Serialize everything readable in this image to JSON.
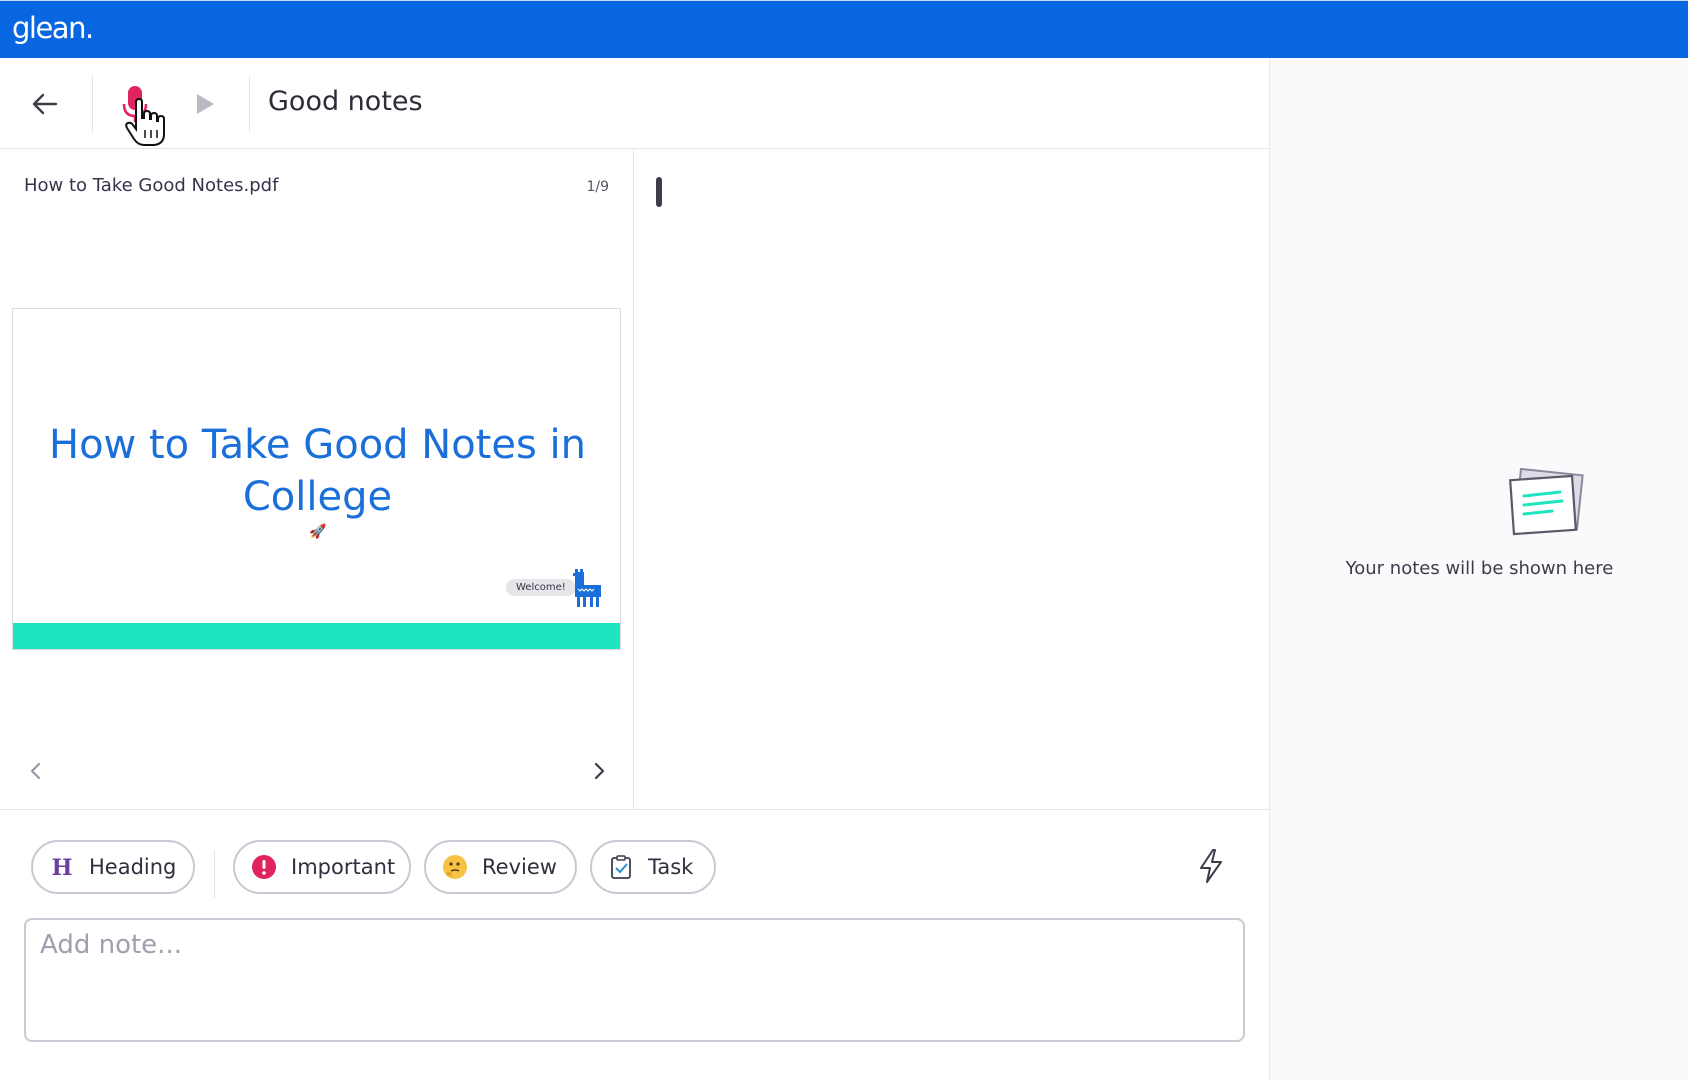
{
  "app": {
    "logo_text": "glean.",
    "brand_color": "#0766e0",
    "accent_teal": "#1de5bf",
    "record_color": "#e0245e"
  },
  "toolbar": {
    "back_icon": "arrow-left-icon",
    "mic_icon": "microphone-icon",
    "play_icon": "play-icon",
    "title": "Good notes"
  },
  "pdf": {
    "file_name": "How to Take Good Notes.pdf",
    "page_indicator": "1/9",
    "slide": {
      "title": "How to Take Good Notes in College",
      "bubble_text": "Welcome!"
    },
    "prev_icon": "chevron-left-icon",
    "next_icon": "chevron-right-icon"
  },
  "tags": [
    {
      "label": "Heading",
      "icon": "heading-icon"
    },
    {
      "label": "Important",
      "icon": "exclamation-icon"
    },
    {
      "label": "Review",
      "icon": "thinking-face-icon"
    },
    {
      "label": "Task",
      "icon": "clipboard-check-icon"
    }
  ],
  "quick_action_icon": "lightning-icon",
  "note_input": {
    "placeholder": "Add note...",
    "value": ""
  },
  "right_panel": {
    "empty_message": "Your notes will be shown here",
    "empty_icon": "notes-stack-icon"
  }
}
